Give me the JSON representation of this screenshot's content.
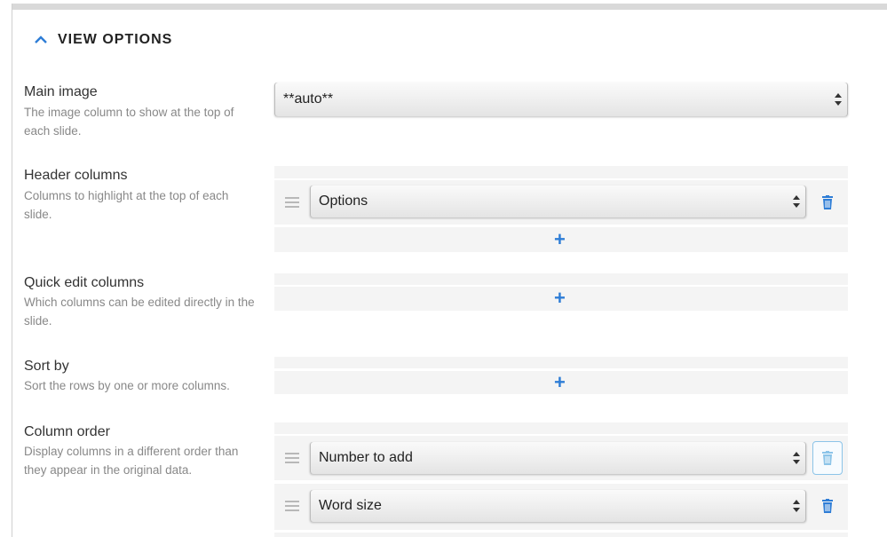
{
  "section": {
    "title": "VIEW OPTIONS"
  },
  "options": {
    "main_image": {
      "title": "Main image",
      "desc": "The image column to show at the top of each slide.",
      "value": "**auto**"
    },
    "header_columns": {
      "title": "Header columns",
      "desc": "Columns to highlight at the top of each slide.",
      "items": [
        "Options"
      ],
      "add_label": "+"
    },
    "quick_edit": {
      "title": "Quick edit columns",
      "desc": "Which columns can be edited directly in the slide.",
      "add_label": "+"
    },
    "sort_by": {
      "title": "Sort by",
      "desc": "Sort the rows by one or more columns.",
      "add_label": "+"
    },
    "column_order": {
      "title": "Column order",
      "desc": "Display columns in a different order than they appear in the original data.",
      "items": [
        "Number to add",
        "Word size"
      ]
    }
  },
  "colors": {
    "accent": "#2e7dd6",
    "strip": "#f4f4f4",
    "desc_text": "#888888"
  }
}
